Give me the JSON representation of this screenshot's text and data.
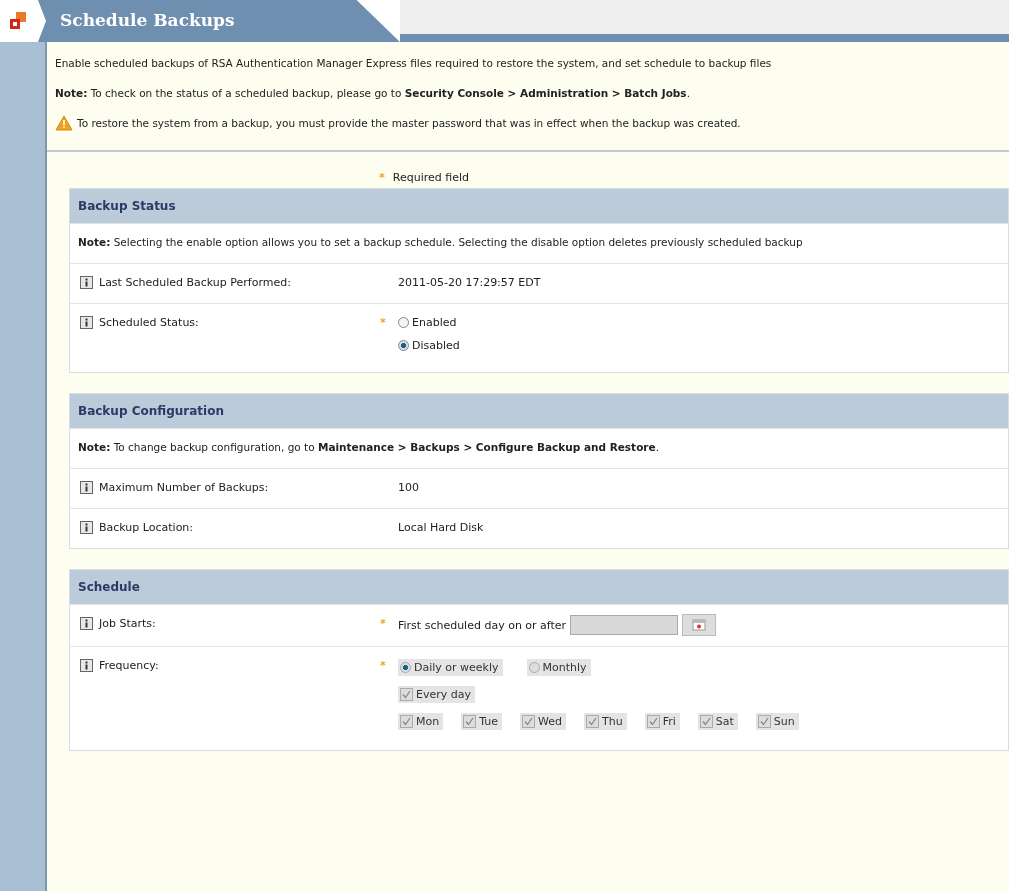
{
  "page_title": "Schedule Backups",
  "intro": {
    "description": "Enable scheduled backups of RSA Authentication Manager Express files required to restore the system, and set schedule to backup files",
    "note": "**Note:** To check on the status of a scheduled backup, please go to **Security Console > Administration > Batch Jobs**.",
    "warning": "To restore the system from a backup, you must provide the master password that was in effect when the backup was created."
  },
  "required_legend": {
    "mark": "*",
    "text": "Required field"
  },
  "sections": [
    {
      "title": "Backup Status",
      "note": "**Note:** Selecting the enable option allows you to set a backup schedule. Selecting the disable option deletes previously scheduled backup",
      "rows": [
        {
          "kind": "text",
          "label": "Last Scheduled Backup Performed:",
          "required": false,
          "value": "2011-05-20 17:29:57 EDT"
        },
        {
          "kind": "radios",
          "label": "Scheduled Status:",
          "required": true,
          "options": [
            {
              "label": "Enabled",
              "selected": false,
              "disabled": false
            },
            {
              "label": "Disabled",
              "selected": true,
              "disabled": false
            }
          ]
        }
      ]
    },
    {
      "title": "Backup Configuration",
      "note": "**Note:** To change backup configuration, go to **Maintenance > Backups > Configure Backup and Restore**.",
      "rows": [
        {
          "kind": "text",
          "label": "Maximum Number of Backups:",
          "required": false,
          "value": "100"
        },
        {
          "kind": "text",
          "label": "Backup Location:",
          "required": false,
          "value": "Local Hard Disk"
        }
      ]
    },
    {
      "title": "Schedule",
      "rows": [
        {
          "kind": "date",
          "label": "Job Starts:",
          "required": true,
          "prefix": "First scheduled day on or after"
        },
        {
          "kind": "frequency",
          "label": "Frequency:",
          "required": true,
          "options": [
            {
              "label": "Daily or weekly",
              "selected": true,
              "disabled": true
            },
            {
              "label": "Monthly",
              "selected": false,
              "disabled": true
            }
          ],
          "every_day": {
            "label": "Every day",
            "checked": true,
            "disabled": true
          },
          "days": [
            {
              "label": "Mon",
              "checked": true,
              "disabled": true
            },
            {
              "label": "Tue",
              "checked": true,
              "disabled": true
            },
            {
              "label": "Wed",
              "checked": true,
              "disabled": true
            },
            {
              "label": "Thu",
              "checked": true,
              "disabled": true
            },
            {
              "label": "Fri",
              "checked": true,
              "disabled": true
            },
            {
              "label": "Sat",
              "checked": true,
              "disabled": true
            },
            {
              "label": "Sun",
              "checked": true,
              "disabled": true
            }
          ]
        }
      ]
    }
  ]
}
